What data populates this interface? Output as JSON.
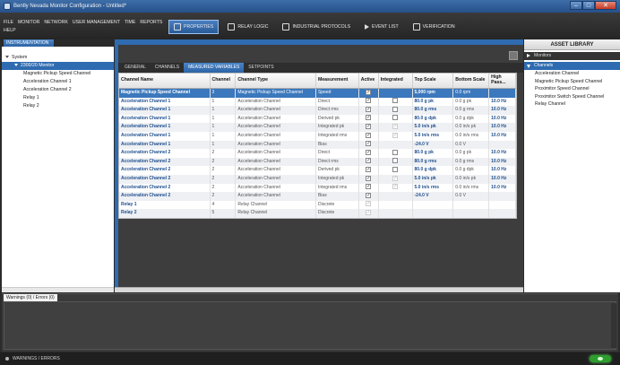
{
  "window": {
    "title": "Bently Nevada Monitor Configuration - Untitled*"
  },
  "menu": [
    "FILE",
    "MONITOR",
    "NETWORK",
    "USER MANAGEMENT",
    "TIME",
    "REPORTS",
    "HELP"
  ],
  "toolbar": [
    {
      "label": "PROPERTIES",
      "icon": "properties-icon",
      "active": true
    },
    {
      "label": "RELAY LOGIC",
      "icon": "relay-logic-icon",
      "active": false
    },
    {
      "label": "INDUSTRIAL PROTOCOLS",
      "icon": "list-icon",
      "active": false
    },
    {
      "label": "EVENT LIST",
      "icon": "flag-icon",
      "active": false
    },
    {
      "label": "VERIFICATION",
      "icon": "verify-icon",
      "active": false
    }
  ],
  "instrumentation": {
    "tab_label": "INSTRUMENTATION",
    "tree": [
      {
        "label": "System",
        "level": 0,
        "expanded": true,
        "selected": false
      },
      {
        "label": "2300/20 Monitor",
        "level": 1,
        "expanded": true,
        "selected": true
      },
      {
        "label": "Magnetic Pickup Speed Channel",
        "level": 2,
        "selected": false
      },
      {
        "label": "Acceleration Channel 1",
        "level": 2,
        "selected": false
      },
      {
        "label": "Acceleration Channel 2",
        "level": 2,
        "selected": false
      },
      {
        "label": "Relay 1",
        "level": 2,
        "selected": false
      },
      {
        "label": "Relay 2",
        "level": 2,
        "selected": false
      }
    ]
  },
  "subtabs": [
    {
      "label": "GENERAL",
      "active": false
    },
    {
      "label": "CHANNELS",
      "active": false
    },
    {
      "label": "MEASURED VARIABLES",
      "active": true
    },
    {
      "label": "SETPOINTS",
      "active": false
    }
  ],
  "table": {
    "columns": [
      "Channel Name",
      "Channel",
      "Channel Type",
      "Measurement",
      "Active",
      "Integrated",
      "Top Scale",
      "Bottom Scale",
      "High Pass..."
    ],
    "rows": [
      {
        "name": "Magnetic Pickup Speed Channel",
        "channel": "3",
        "type": "Magnetic Pickup Speed Channel",
        "measurement": "Speed",
        "active": true,
        "integrated": "none",
        "top": "5,000 rpm",
        "bottom": "0.0 rpm",
        "hp": "",
        "selected": true
      },
      {
        "name": "Acceleration Channel 1",
        "channel": "1",
        "type": "Acceleration Channel",
        "measurement": "Direct",
        "active": true,
        "integrated": "unchecked",
        "top": "80.0 g pk",
        "bottom": "0.0 g pk",
        "hp": "10.0 Hz"
      },
      {
        "name": "Acceleration Channel 1",
        "channel": "1",
        "type": "Acceleration Channel",
        "measurement": "Direct rms",
        "active": true,
        "integrated": "unchecked",
        "top": "80.0 g rms",
        "bottom": "0.0 g rms",
        "hp": "10.0 Hz"
      },
      {
        "name": "Acceleration Channel 1",
        "channel": "1",
        "type": "Acceleration Channel",
        "measurement": "Derived pk",
        "active": true,
        "integrated": "unchecked",
        "top": "80.0 g dpk",
        "bottom": "0.0 g dpk",
        "hp": "10.0 Hz"
      },
      {
        "name": "Acceleration Channel 1",
        "channel": "1",
        "type": "Acceleration Channel",
        "measurement": "Integrated pk",
        "active": true,
        "integrated": "checked-disabled",
        "top": "5.0 in/s pk",
        "bottom": "0.0 in/s pk",
        "hp": "10.0 Hz"
      },
      {
        "name": "Acceleration Channel 1",
        "channel": "1",
        "type": "Acceleration Channel",
        "measurement": "Integrated rms",
        "active": true,
        "integrated": "checked-disabled",
        "top": "5.0 in/s rms",
        "bottom": "0.0 in/s rms",
        "hp": "10.0 Hz"
      },
      {
        "name": "Acceleration Channel 1",
        "channel": "1",
        "type": "Acceleration Channel",
        "measurement": "Bias",
        "active": true,
        "integrated": "none",
        "top": "-24.0 V",
        "bottom": "0.0 V",
        "hp": ""
      },
      {
        "name": "Acceleration Channel 2",
        "channel": "2",
        "type": "Acceleration Channel",
        "measurement": "Direct",
        "active": true,
        "integrated": "unchecked",
        "top": "80.0 g pk",
        "bottom": "0.0 g pk",
        "hp": "10.0 Hz"
      },
      {
        "name": "Acceleration Channel 2",
        "channel": "2",
        "type": "Acceleration Channel",
        "measurement": "Direct rms",
        "active": true,
        "integrated": "unchecked",
        "top": "80.0 g rms",
        "bottom": "0.0 g rms",
        "hp": "10.0 Hz"
      },
      {
        "name": "Acceleration Channel 2",
        "channel": "2",
        "type": "Acceleration Channel",
        "measurement": "Derived pk",
        "active": true,
        "integrated": "unchecked",
        "top": "80.0 g dpk",
        "bottom": "0.0 g dpk",
        "hp": "10.0 Hz"
      },
      {
        "name": "Acceleration Channel 2",
        "channel": "2",
        "type": "Acceleration Channel",
        "measurement": "Integrated pk",
        "active": true,
        "integrated": "checked-disabled",
        "top": "5.0 in/s pk",
        "bottom": "0.0 in/s pk",
        "hp": "10.0 Hz"
      },
      {
        "name": "Acceleration Channel 2",
        "channel": "2",
        "type": "Acceleration Channel",
        "measurement": "Integrated rms",
        "active": true,
        "integrated": "checked-disabled",
        "top": "5.0 in/s rms",
        "bottom": "0.0 in/s rms",
        "hp": "10.0 Hz"
      },
      {
        "name": "Acceleration Channel 2",
        "channel": "2",
        "type": "Acceleration Channel",
        "measurement": "Bias",
        "active": true,
        "integrated": "none",
        "top": "-24.0 V",
        "bottom": "0.0 V",
        "hp": ""
      },
      {
        "name": "Relay 1",
        "channel": "4",
        "type": "Relay Channel",
        "measurement": "Discrete",
        "active": "disabled",
        "integrated": "none",
        "top": "",
        "bottom": "",
        "hp": ""
      },
      {
        "name": "Relay 2",
        "channel": "5",
        "type": "Relay Channel",
        "measurement": "Discrete",
        "active": "disabled",
        "integrated": "none",
        "top": "",
        "bottom": "",
        "hp": ""
      }
    ]
  },
  "asset_library": {
    "title": "ASSET LIBRARY",
    "sections": [
      {
        "label": "Monitors",
        "expanded": false,
        "items": []
      },
      {
        "label": "Channels",
        "expanded": true,
        "items": [
          "Acceleration Channel",
          "Magnetic Pickup Speed Channel",
          "Proximitor Speed Channel",
          "Proximitor Switch Speed Channel",
          "Relay Channel"
        ]
      }
    ]
  },
  "warnings": {
    "tab_label": "Warnings (0) / Errors (0)"
  },
  "statusbar": {
    "label": "WARNINGS / ERRORS"
  },
  "colors": {
    "accent": "#2f6bb0",
    "connected": "#2e9d2e"
  }
}
